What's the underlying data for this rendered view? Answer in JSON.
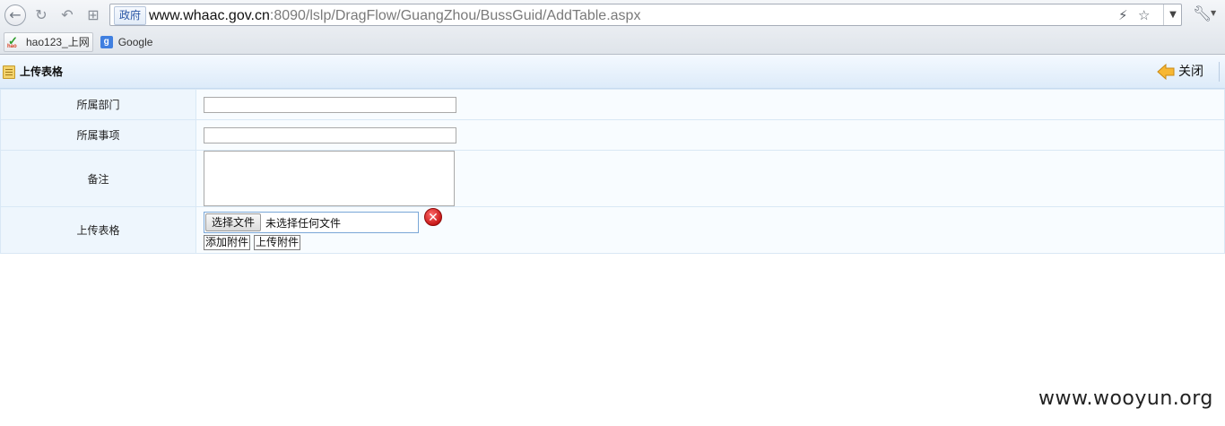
{
  "browser": {
    "address_badge": "政府",
    "url_host": "www.whaac.gov.cn",
    "url_rest": ":8090/lslp/DragFlow/GuangZhou/BussGuid/AddTable.aspx",
    "bookmarks": [
      {
        "label": "hao123_上网",
        "icon": "hao123-icon"
      },
      {
        "label": "Google",
        "icon": "google-icon"
      }
    ]
  },
  "panel": {
    "title": "上传表格",
    "close_label": "关闭"
  },
  "form": {
    "department_label": "所属部门",
    "department_value": "",
    "matter_label": "所属事项",
    "matter_value": "",
    "note_label": "备注",
    "note_value": "",
    "upload_label": "上传表格",
    "choose_file_label": "选择文件",
    "file_status": "未选择任何文件",
    "add_attachment_label": "添加附件",
    "upload_attachment_label": "上传附件"
  },
  "watermark": "www.wooyun.org",
  "colors": {
    "title_bar": "#ddebf9",
    "label_cell": "#eef6fd",
    "border": "#d9e8f5"
  }
}
